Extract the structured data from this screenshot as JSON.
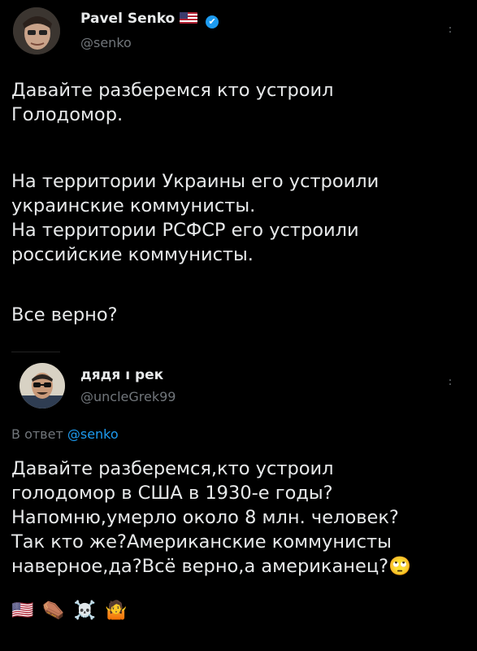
{
  "post1": {
    "author_name": "Pavel Senko",
    "handle": "@senko",
    "flag_icon": "us-flag-icon",
    "verified_icon": "✔",
    "paragraphs": [
      [
        "Давайте разберемся кто устроил",
        "Голодомор."
      ],
      [
        "На территории Украины его устроили",
        "украинские коммунисты.",
        "На территории РСФСР его устроили",
        "российские коммунисты."
      ],
      [
        "Все верно?"
      ]
    ]
  },
  "post2": {
    "author_name": "дядя ı рек",
    "handle": "@uncleGrek99",
    "reply_label": "В ответ",
    "reply_mention": "@senko",
    "lines": [
      "Давайте разберемся,кто устроил",
      "голодомор в США в 1930-е годы?",
      "Напомню,умерло около 8 млн. человек?",
      "Так кто же?Американские коммунисты",
      "наверное,да?Всё верно,а американец?🙄"
    ],
    "emojis": [
      "🇺🇸",
      "⚰️",
      "☠️",
      "🤷"
    ]
  },
  "colors": {
    "background": "#000000",
    "text": "#e7e9ea",
    "secondary": "#71767b",
    "accent": "#1d9bf0"
  }
}
